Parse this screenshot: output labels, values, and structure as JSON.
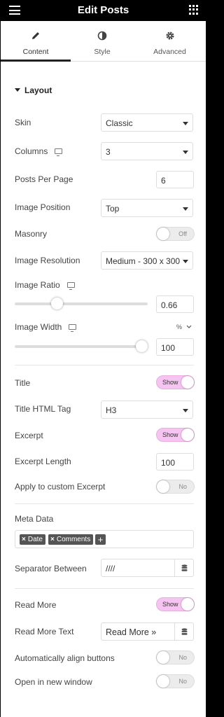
{
  "header": {
    "title": "Edit Posts",
    "menu_icon": "hamburger-icon",
    "apps_icon": "grid-icon"
  },
  "tabs": [
    {
      "label": "Content",
      "icon": "pencil-icon",
      "active": true
    },
    {
      "label": "Style",
      "icon": "contrast-icon",
      "active": false
    },
    {
      "label": "Advanced",
      "icon": "gear-icon",
      "active": false
    }
  ],
  "section": {
    "title": "Layout"
  },
  "controls": {
    "skin": {
      "label": "Skin",
      "value": "Classic"
    },
    "columns": {
      "label": "Columns",
      "value": "3"
    },
    "posts_per_page": {
      "label": "Posts Per Page",
      "value": "6"
    },
    "image_position": {
      "label": "Image Position",
      "value": "Top"
    },
    "masonry": {
      "label": "Masonry",
      "state": "Off"
    },
    "image_resolution": {
      "label": "Image Resolution",
      "value": "Medium - 300 x 300"
    },
    "image_ratio": {
      "label": "Image Ratio",
      "value": "0.66",
      "fraction": 0.3
    },
    "image_width": {
      "label": "Image Width",
      "unit": "%",
      "value": "100",
      "fraction": 1.0
    },
    "title": {
      "label": "Title",
      "state": "Show"
    },
    "title_html_tag": {
      "label": "Title HTML Tag",
      "value": "H3"
    },
    "excerpt": {
      "label": "Excerpt",
      "state": "Show"
    },
    "excerpt_length": {
      "label": "Excerpt Length",
      "value": "100"
    },
    "apply_custom_excerpt": {
      "label": "Apply to custom Excerpt",
      "state": "No"
    },
    "meta_data": {
      "label": "Meta Data",
      "tags": [
        "Date",
        "Comments"
      ],
      "add": "+"
    },
    "separator_between": {
      "label": "Separator Between",
      "value": "////"
    },
    "read_more": {
      "label": "Read More",
      "state": "Show"
    },
    "read_more_text": {
      "label": "Read More Text",
      "value": "Read More »"
    },
    "align_buttons": {
      "label": "Automatically align buttons",
      "state": "No"
    },
    "new_window": {
      "label": "Open in new window",
      "state": "No"
    }
  },
  "colors": {
    "toggle_on": "#f6c4f0",
    "toggle_off": "#ececec",
    "topbar": "#000000"
  }
}
